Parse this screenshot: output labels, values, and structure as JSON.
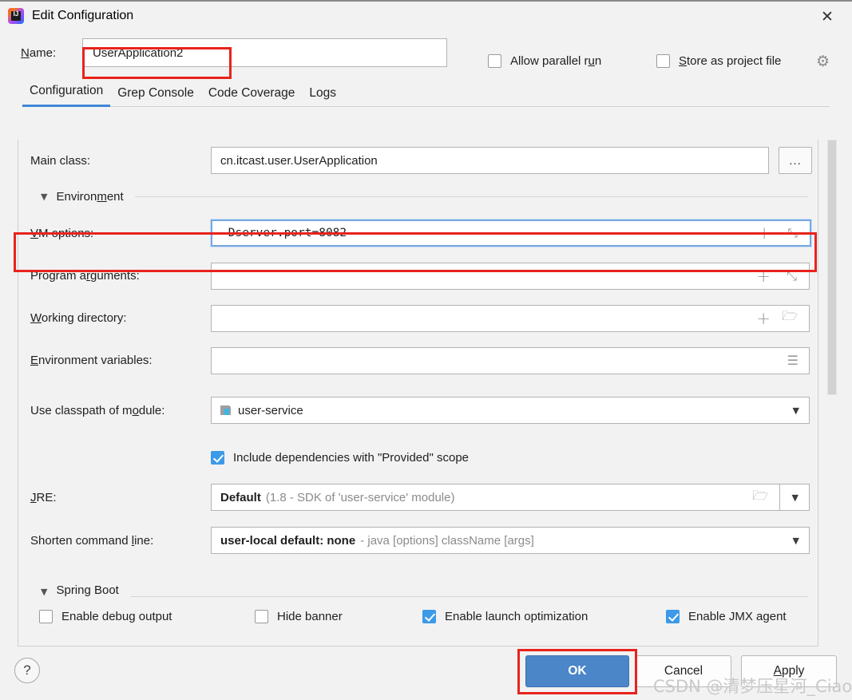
{
  "window": {
    "title": "Edit Configuration",
    "app_icon": "intellij-idea-icon",
    "close_icon": "✕"
  },
  "name_row": {
    "label": "Name:",
    "value": "UserApplication2",
    "allow_parallel_run": {
      "label_pre": "Allow parallel r",
      "label_mn": "u",
      "label_post": "n",
      "checked": false
    },
    "store_as_project_file": {
      "label_mn": "S",
      "label_post": "tore as project file",
      "checked": false
    },
    "gear_icon": "⚙"
  },
  "tabs": [
    {
      "label": "Configuration",
      "active": true
    },
    {
      "label": "Grep Console",
      "active": false
    },
    {
      "label": "Code Coverage",
      "active": false
    },
    {
      "label": "Logs",
      "active": false
    }
  ],
  "form": {
    "main_class": {
      "label": "Main class:",
      "value": "cn.itcast.user.UserApplication",
      "browse_label": "..."
    },
    "environment_section": {
      "pre": "Environ",
      "mn": "m",
      "post": "ent",
      "triangle": "▼"
    },
    "vm_options": {
      "label_mn": "V",
      "label_post": "M options:",
      "value": "-Dserver.port=8082",
      "plus_icon": "+",
      "expand_icon": "⤡",
      "focused": true
    },
    "program_arguments": {
      "label_pre": "Program a",
      "label_mn": "r",
      "label_post": "guments:",
      "value": "",
      "plus_icon": "+",
      "expand_icon": "⤡"
    },
    "working_directory": {
      "label_mn": "W",
      "label_post": "orking directory:",
      "value": "",
      "plus_icon": "+",
      "folder_icon": "🗁"
    },
    "environment_variables": {
      "label_mn": "E",
      "label_post": "nvironment variables:",
      "value": "",
      "list_icon": "☰"
    },
    "use_classpath_of_module": {
      "label_pre": "Use classpath of m",
      "label_mn": "o",
      "label_post": "dule:",
      "value": "user-service",
      "caret": "▼"
    },
    "include_provided_scope": {
      "label": "Include dependencies with \"Provided\" scope",
      "checked": true
    },
    "jre": {
      "label_mn": "J",
      "label_post": "RE:",
      "value_bold": "Default",
      "value_gray": "(1.8 - SDK of 'user-service' module)",
      "folder_icon": "🗁",
      "caret": "▼"
    },
    "shorten_command_line": {
      "label_pre": "Shorten command ",
      "label_mn": "l",
      "label_post": "ine:",
      "value_bold": "user-local default: none",
      "value_gray": "- java [options] className [args]",
      "caret": "▼"
    },
    "spring_boot_section": {
      "title": "Spring Boot",
      "triangle": "▼"
    },
    "spring_boot_checkboxes": [
      {
        "label": "Enable debug output",
        "checked": false
      },
      {
        "label": "Hide banner",
        "checked": false
      },
      {
        "label": "Enable launch optimization",
        "checked": true
      },
      {
        "label": "Enable JMX agent",
        "checked": true
      }
    ]
  },
  "footer": {
    "help_icon": "?",
    "ok": "OK",
    "cancel": "Cancel",
    "apply": "Apply"
  },
  "watermark": "CSDN @清梦压星河_Ciao",
  "colors": {
    "accent_blue": "#4a86c8",
    "checkbox_blue": "#3c9ae8",
    "tab_underline": "#4187d6",
    "annotation_red": "#e8231d",
    "focus_border": "#74a7e0"
  }
}
